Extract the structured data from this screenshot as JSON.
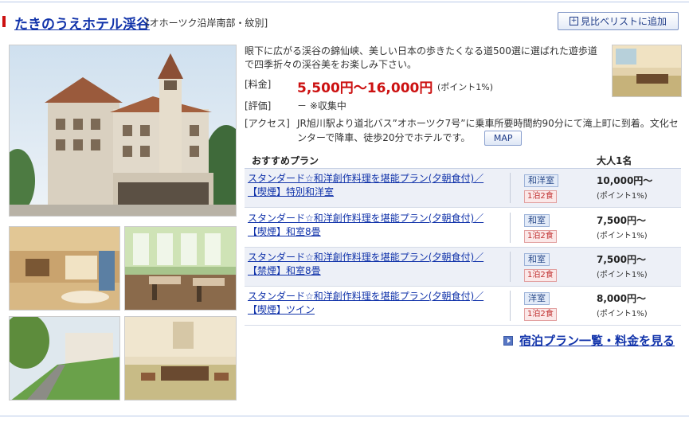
{
  "hotel": {
    "name": "たきのうえホテル渓谷",
    "region": "[オホーツク沿岸南部・紋別]",
    "compare_button": "見比べリストに追加",
    "compare_icon": "plus-box-icon",
    "description": "眼下に広がる渓谷の錦仙峡、美しい日本の歩きたくなる道500選に選ばれた遊歩道で四季折々の渓谷美をお楽しみ下さい。"
  },
  "info": {
    "price_label": "[料金]",
    "price_range": "5,500円〜16,000円",
    "price_point": "(ポイント1%)",
    "rating_label": "[評価]",
    "rating_value": "－ ※収集中",
    "access_label": "[アクセス]",
    "access_value": "JR旭川駅より道北バス”オホーツク7号”に乗車所要時間約90分にて滝上町に到着。文化センターで降車、徒歩20分でホテルです。",
    "map_button": "MAP"
  },
  "plans": {
    "header_title": "おすすめプラン",
    "header_adult": "大人1名",
    "items": [
      {
        "name": "スタンダード☆和洋創作料理を堪能プラン(夕朝食付)／【喫煙】特別和洋室",
        "room_type": "和洋室",
        "meals": "1泊2食",
        "price": "10,000円〜",
        "points": "(ポイント1%)"
      },
      {
        "name": "スタンダード☆和洋創作料理を堪能プラン(夕朝食付)／【喫煙】和室8畳",
        "room_type": "和室",
        "meals": "1泊2食",
        "price": "7,500円〜",
        "points": "(ポイント1%)"
      },
      {
        "name": "スタンダード☆和洋創作料理を堪能プラン(夕朝食付)／【禁煙】和室8畳",
        "room_type": "和室",
        "meals": "1泊2食",
        "price": "7,500円〜",
        "points": "(ポイント1%)"
      },
      {
        "name": "スタンダード☆和洋創作料理を堪能プラン(夕朝食付)／【喫煙】ツイン",
        "room_type": "洋室",
        "meals": "1泊2食",
        "price": "8,000円〜",
        "points": "(ポイント1%)"
      }
    ],
    "more_link": "宿泊プラン一覧・料金を見る",
    "more_icon": "arrow-right-icon"
  },
  "colors": {
    "link": "#1133aa",
    "price": "#cc1111",
    "accent_bar": "#cc1111",
    "alt_row": "#edf0f7"
  }
}
